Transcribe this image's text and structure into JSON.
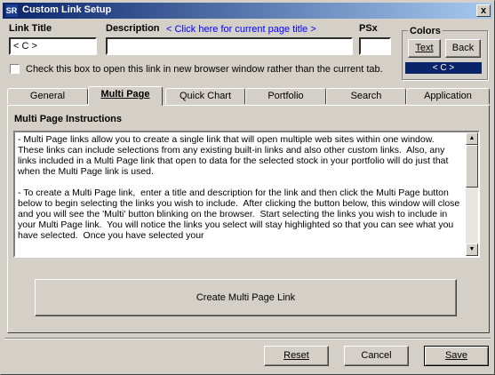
{
  "window": {
    "title": "Custom Link Setup",
    "close_glyph": "x",
    "app_icon_text": "SR"
  },
  "fields": {
    "link_title_label": "Link Title",
    "link_title_value": "< C >",
    "description_label": "Description",
    "description_link": "< Click here for current page title >",
    "description_value": "",
    "psx_label": "PSx",
    "psx_value": ""
  },
  "colors": {
    "label": "Colors",
    "text_button": "Text",
    "back_button": "Back",
    "swatch_text": "< C >",
    "swatch_bg": "#0a246a",
    "swatch_fg": "#ffffff"
  },
  "new_window_checkbox": {
    "checked": false,
    "label": "Check this box to open this link in new browser window rather than the current tab."
  },
  "tabs": [
    {
      "label": "General",
      "active": false
    },
    {
      "label": "Multi Page",
      "active": true
    },
    {
      "label": "Quick Chart",
      "active": false
    },
    {
      "label": "Portfolio",
      "active": false
    },
    {
      "label": "Search",
      "active": false
    },
    {
      "label": "Application",
      "active": false
    }
  ],
  "multi_page": {
    "heading": "Multi Page Instructions",
    "instructions": "- Multi Page links allow you to create a single link that will open multiple web sites within one window.  These links can include selections from any existing built-in links and also other custom links.  Also, any links included in a Multi Page link that open to data for the selected stock in your portfolio will do just that when the Multi Page link is used.\n\n- To create a Multi Page link,  enter a title and description for the link and then click the Multi Page button below to begin selecting the links you wish to include.  After clicking the button below, this window will close and you will see the 'Multi' button blinking on the browser.  Start selecting the links you wish to include in your Multi Page link.  You will notice the links you select will stay highlighted so that you can see what you have selected.  Once you have selected your",
    "create_button": "Create Multi Page Link"
  },
  "footer": {
    "reset": "Reset",
    "cancel": "Cancel",
    "save": "Save"
  }
}
